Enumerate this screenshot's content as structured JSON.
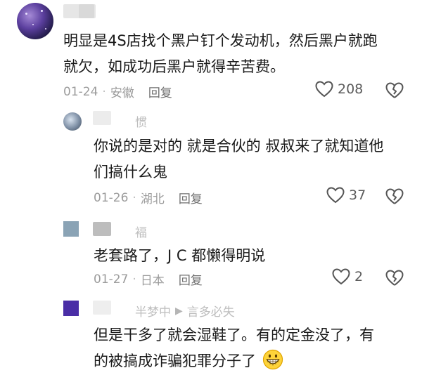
{
  "comments": [
    {
      "text_lines": [
        "明显是4S店找个黑户钉个发动机，然后黑户就跑",
        "就欠，如成功后黑户就得辛苦费。"
      ],
      "date": "01-24",
      "location": "安徽",
      "reply_label": "回复",
      "likes": "208",
      "avatar_icon": "galaxy-avatar"
    }
  ],
  "replies": [
    {
      "username": "惯",
      "text_lines": [
        "你说的是对的 就是合伙的 叔叔来了就知道他",
        "们搞什么鬼"
      ],
      "date": "01-26",
      "location": "湖北",
      "reply_label": "回复",
      "likes": "37",
      "avatar_color": "#7d8ea4"
    },
    {
      "username": "褔",
      "text_lines": [
        "老套路了，J C 都懒得明说"
      ],
      "date": "01-27",
      "location": "日本",
      "reply_label": "回复",
      "likes": "2",
      "avatar_color": "#8aa3b5"
    },
    {
      "username": "半梦中",
      "reply_to": "言多必失",
      "text_lines": [
        "但是干多了就会湿鞋了。有的定金没了，有",
        "的被搞成诈骗犯罪分子了"
      ],
      "emoji": "grinning-face",
      "avatar_color": "#4a2ea6"
    }
  ],
  "separator": "·",
  "icons": {
    "like": "heart-outline-icon",
    "dislike": "broken-heart-icon"
  },
  "colors": {
    "text": "#1a1a1a",
    "meta": "#9c9c9c",
    "username": "#bdbdbd"
  }
}
